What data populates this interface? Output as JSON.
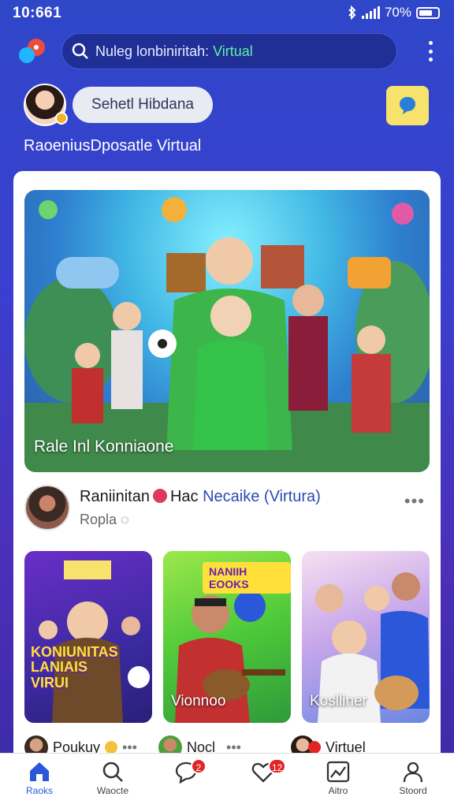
{
  "status": {
    "time": "10:661",
    "battery": "70%"
  },
  "search": {
    "text_plain": "Nuleg lonbiniritah:",
    "text_highlight": "Virtual"
  },
  "profile": {
    "button_label": "Sehetl Hibdana"
  },
  "caption": "RaoeniusDposatle Virtual",
  "hero": {
    "label": "Rale Inl Konniaone"
  },
  "post": {
    "name": "Raniinitan",
    "tag": "Hac",
    "link": "Necaike (Virtura)",
    "sub": "Roplа"
  },
  "tiles": [
    {
      "banner": "",
      "big_banner": "KONIUNITAS LANIAIS VIRUI",
      "label": ""
    },
    {
      "banner": "NANIIH EOOKS",
      "big_banner": "",
      "label": "Vionnoo"
    },
    {
      "banner": "",
      "big_banner": "",
      "label": "Koslliner"
    }
  ],
  "mini": [
    {
      "text": "Poukuy"
    },
    {
      "text": "Nocl"
    },
    {
      "text": "Virtuel"
    }
  ],
  "nav": [
    {
      "label": "Raoks"
    },
    {
      "label": "Waocte"
    },
    {
      "label": "",
      "badge": "2"
    },
    {
      "label": "",
      "badge": "12"
    },
    {
      "label": "Aitro"
    },
    {
      "label": "Stoord"
    }
  ],
  "colors": {
    "primary": "#2b58d9",
    "highlight": "#5ef0a8",
    "badge": "#e32424"
  }
}
